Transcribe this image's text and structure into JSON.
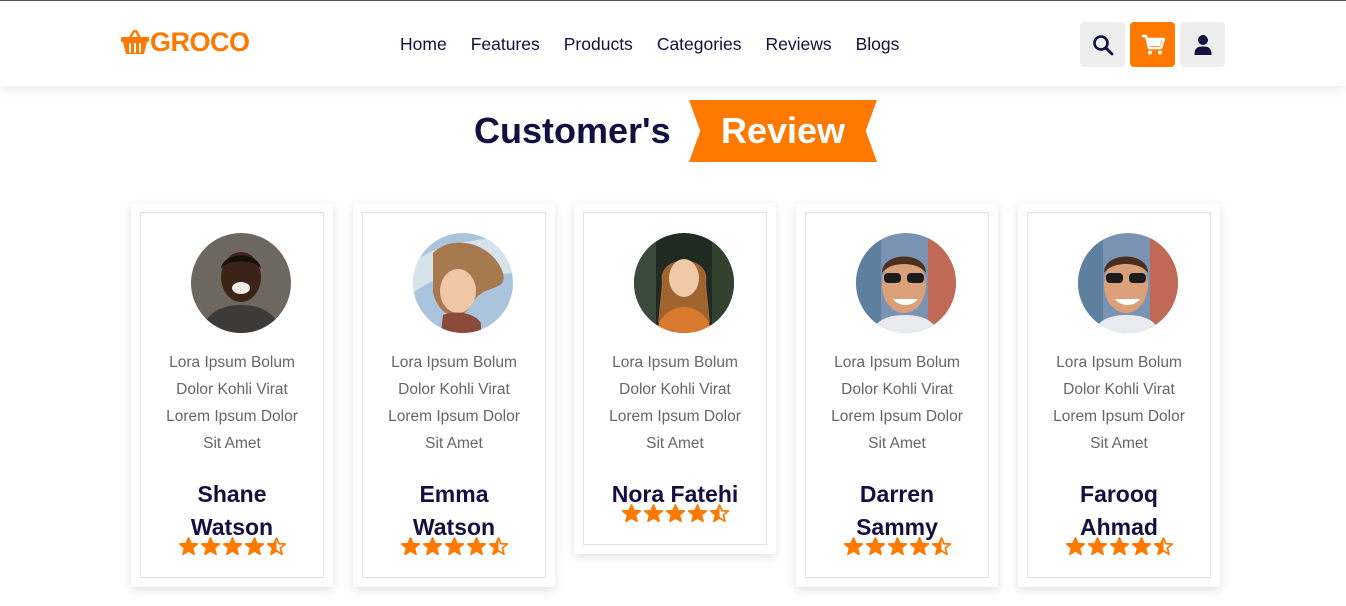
{
  "brand": {
    "name": "GROCO",
    "accent_color": "#ff7800",
    "text_color": "#130f40"
  },
  "nav": {
    "items": [
      {
        "label": "Home"
      },
      {
        "label": "Features"
      },
      {
        "label": "Products"
      },
      {
        "label": "Categories"
      },
      {
        "label": "Reviews"
      },
      {
        "label": "Blogs"
      }
    ]
  },
  "header_icons": [
    {
      "icon": "search-icon"
    },
    {
      "icon": "cart-icon",
      "active": true
    },
    {
      "icon": "user-icon"
    }
  ],
  "section": {
    "title_plain": "Customer's",
    "title_accent": "Review"
  },
  "reviews": [
    {
      "text_lines": [
        "Lora Ipsum Bolum",
        "Dolor Kohli Virat",
        "Lorem Ipsum Dolor",
        "Sit Amet"
      ],
      "name_lines": [
        "Shane",
        "Watson"
      ],
      "rating": 4.5
    },
    {
      "text_lines": [
        "Lora Ipsum Bolum",
        "Dolor Kohli Virat",
        "Lorem Ipsum Dolor",
        "Sit Amet"
      ],
      "name_lines": [
        "Emma",
        "Watson"
      ],
      "rating": 4.5
    },
    {
      "text_lines": [
        "Lora Ipsum Bolum",
        "Dolor Kohli Virat",
        "Lorem Ipsum Dolor",
        "Sit Amet"
      ],
      "name_lines": [
        "Nora Fatehi"
      ],
      "rating": 4.5
    },
    {
      "text_lines": [
        "Lora Ipsum Bolum",
        "Dolor Kohli Virat",
        "Lorem Ipsum Dolor",
        "Sit Amet"
      ],
      "name_lines": [
        "Darren",
        "Sammy"
      ],
      "rating": 4.5
    },
    {
      "text_lines": [
        "Lora Ipsum Bolum",
        "Dolor Kohli Virat",
        "Lorem Ipsum Dolor",
        "Sit Amet"
      ],
      "name_lines": [
        "Farooq",
        "Ahmad"
      ],
      "rating": 4.5
    }
  ]
}
